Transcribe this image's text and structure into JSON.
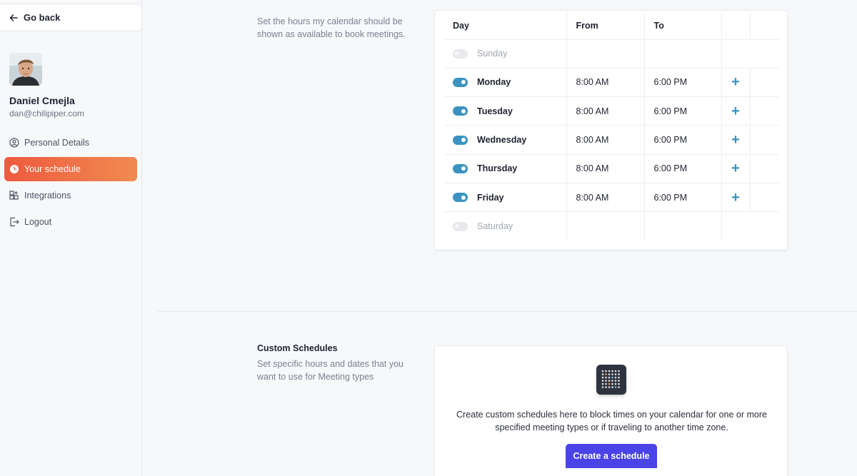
{
  "sidebar": {
    "go_back_label": "Go back",
    "user": {
      "name": "Daniel Cmejla",
      "email": "dan@chilipiper.com"
    },
    "items": [
      {
        "label": "Personal Details",
        "icon": "user-circle-icon",
        "active": false
      },
      {
        "label": "Your schedule",
        "icon": "clock-icon",
        "active": true
      },
      {
        "label": "Integrations",
        "icon": "grid-plus-icon",
        "active": false
      },
      {
        "label": "Logout",
        "icon": "logout-icon",
        "active": false
      }
    ]
  },
  "working_hours": {
    "description": "Set the hours my calendar should be shown as available to book meetings.",
    "columns": {
      "day": "Day",
      "from": "From",
      "to": "To"
    },
    "days": [
      {
        "day": "Sunday",
        "enabled": false,
        "from": "",
        "to": ""
      },
      {
        "day": "Monday",
        "enabled": true,
        "from": "8:00 AM",
        "to": "6:00 PM"
      },
      {
        "day": "Tuesday",
        "enabled": true,
        "from": "8:00 AM",
        "to": "6:00 PM"
      },
      {
        "day": "Wednesday",
        "enabled": true,
        "from": "8:00 AM",
        "to": "6:00 PM"
      },
      {
        "day": "Thursday",
        "enabled": true,
        "from": "8:00 AM",
        "to": "6:00 PM"
      },
      {
        "day": "Friday",
        "enabled": true,
        "from": "8:00 AM",
        "to": "6:00 PM"
      },
      {
        "day": "Saturday",
        "enabled": false,
        "from": "",
        "to": ""
      }
    ],
    "add_symbol": "+"
  },
  "custom_schedules": {
    "title": "Custom Schedules",
    "description": "Set specific hours and dates that you want to use for Meeting types",
    "empty_text": "Create custom schedules here to block times on your calendar for one or more specified meeting types or if traveling to another time zone.",
    "create_button": "Create a schedule"
  },
  "colors": {
    "accent_orange": "#ee5a3f",
    "toggle_blue": "#3a93c0",
    "button_purple": "#4a43e8"
  }
}
